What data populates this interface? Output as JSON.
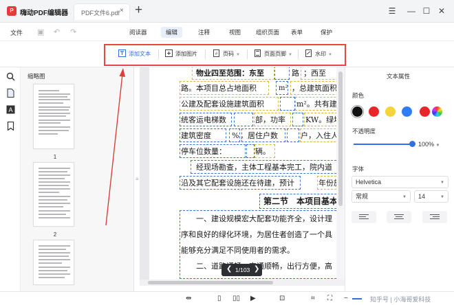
{
  "app": {
    "name": "嗨动PDF编辑器"
  },
  "tabs": [
    {
      "label": "PDF文件6.pdf",
      "close": "×"
    }
  ],
  "new_tab": "+",
  "window_controls": {
    "menu": "☰",
    "minimize": "—",
    "maximize": "☐",
    "close": "✕"
  },
  "menu": {
    "file": "文件",
    "tabs": [
      "阅读器",
      "编辑",
      "注释",
      "视图",
      "组织页面",
      "表单",
      "保护"
    ],
    "active": "编辑"
  },
  "toolbar": {
    "add_text": "添加文本",
    "add_image": "添加图片",
    "page_number": "页码",
    "header_footer": "页面页脚",
    "watermark": "水印"
  },
  "sidebar": {
    "title": "缩略图",
    "page_labels": [
      "1",
      "2"
    ]
  },
  "document": {
    "lines": [
      "物业四至范围：东至",
      "路。本项目总占地面积",
      "公建及配套设施建筑面积",
      "统客运电梯数",
      "建筑密度",
      "停车位数量：",
      "经现场勘查，主体工程基本完工，院内道",
      "沿及其它配套设施还在待建，预计",
      "第二节　本项目基本",
      "一、建设规模宏大配套功能齐全，设计理",
      "序和良好的绿化环境，为居住者创造了一个具",
      "能够充分满足不同使用者的需求。",
      "二、道路通畅，交通顺畅，出行方便，高"
    ],
    "fragments": {
      "road_w": "路",
      "west": "；西至",
      "m2_a": "m²",
      "total_area": "，总建筑面积为",
      "m2_b": "m²。共有建筑",
      "bu": "部，功率",
      "kw": "KW。绿地面",
      "pct": "%",
      "residents": "，居住户数",
      "hu": "户，入住人",
      "liang": "辆。",
      "year": "年份施"
    }
  },
  "pager": {
    "prev": "❮",
    "text": "1/103",
    "next": "❯"
  },
  "properties": {
    "title": "文本属性",
    "color_label": "颜色",
    "colors": [
      "#111111",
      "#e8262a",
      "#f5d33a",
      "#2e7cf6",
      "#e8262a"
    ],
    "opacity_label": "不透明度",
    "opacity": "100%",
    "opacity_fraction": 1.0,
    "font_label": "字体",
    "font": "Helvetica",
    "style": "常规",
    "size": "14"
  },
  "statusbar": {
    "watermark": "知乎号 | 小海哥爱科技"
  },
  "accent": {
    "highlight_border": "#e8453c",
    "selection_box": "#3e74c7",
    "primary": "#2f6fe0"
  }
}
